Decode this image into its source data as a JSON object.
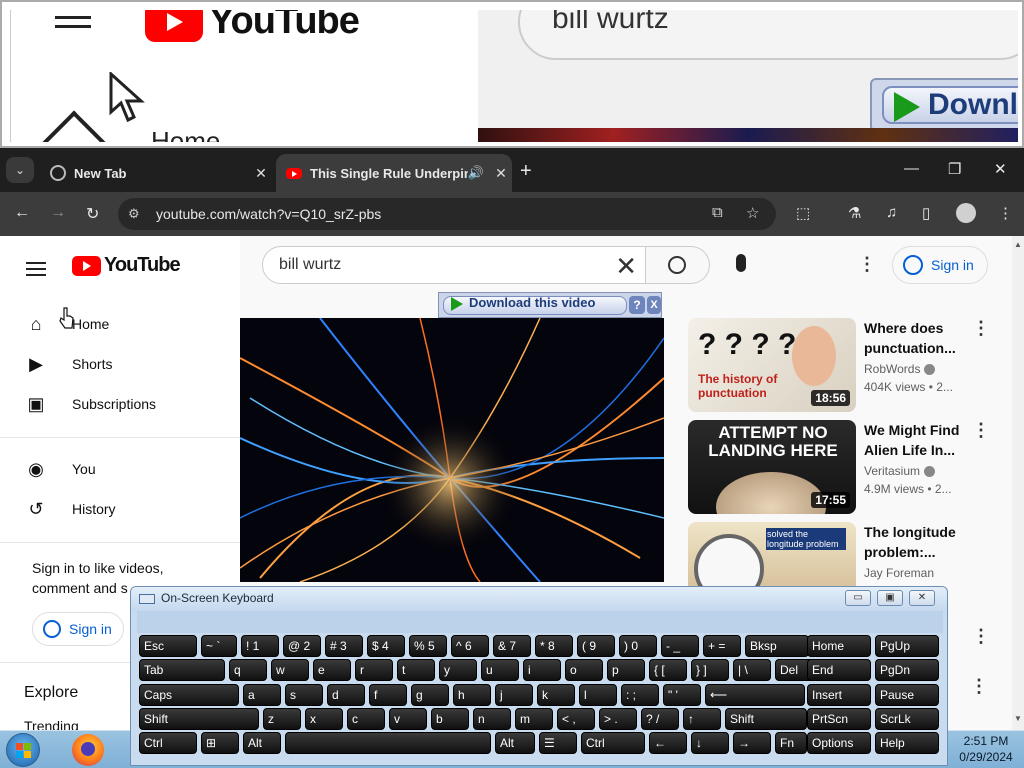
{
  "zoom": {
    "search_text": "bill wurtz",
    "logo": "YouTube",
    "home": "Home",
    "download": "Downl"
  },
  "browser": {
    "tabs": [
      {
        "label": "New Tab",
        "icon": "globe-icon"
      },
      {
        "label": "This Single Rule Underpins",
        "icon": "youtube-favicon",
        "active": true
      }
    ],
    "url": "youtube.com/watch?v=Q10_srZ-pbs"
  },
  "youtube": {
    "logo": "YouTube",
    "search_query": "bill wurtz",
    "sign_in": "Sign in",
    "sidebar": {
      "items": [
        {
          "label": "Home",
          "icon": "home-icon"
        },
        {
          "label": "Shorts",
          "icon": "shorts-icon"
        },
        {
          "label": "Subscriptions",
          "icon": "subscriptions-icon"
        },
        {
          "label": "You",
          "icon": "you-icon"
        },
        {
          "label": "History",
          "icon": "history-icon"
        }
      ],
      "signin_prompt": "Sign in to like videos, comment and s",
      "signin_button": "Sign in",
      "explore": "Explore",
      "trending": "Trending"
    },
    "download_bar": {
      "label": "Download this video",
      "help": "?",
      "close": "X"
    },
    "recommendations": [
      {
        "title": "Where does punctuation...",
        "channel": "RobWords",
        "views": "404K views • 2...",
        "duration": "18:56",
        "thumb_text": "The history of punctuation"
      },
      {
        "title": "We Might Find Alien Life In...",
        "channel": "Veritasium",
        "views": "4.9M views • 2...",
        "duration": "17:55",
        "thumb_text": "ATTEMPT NO LANDING HERE"
      },
      {
        "title": "The longitude problem:...",
        "channel": "Jay Foreman",
        "views": "",
        "duration": "",
        "thumb_text": "solved the longitude problem"
      }
    ]
  },
  "osk": {
    "title": "On-Screen Keyboard",
    "rows": [
      [
        [
          "Esc",
          ""
        ],
        [
          "~ `",
          ""
        ],
        [
          "! 1",
          ""
        ],
        [
          "@ 2",
          ""
        ],
        [
          "# 3",
          ""
        ],
        [
          "$ 4",
          ""
        ],
        [
          "% 5",
          ""
        ],
        [
          "^ 6",
          ""
        ],
        [
          "& 7",
          ""
        ],
        [
          "* 8",
          ""
        ],
        [
          "( 9",
          ""
        ],
        [
          ") 0",
          ""
        ],
        [
          "- _",
          ""
        ],
        [
          "+ =",
          ""
        ],
        [
          "Bksp",
          ""
        ],
        [
          "Home",
          ""
        ],
        [
          "PgUp",
          ""
        ]
      ],
      [
        [
          "Tab",
          ""
        ],
        [
          "q",
          ""
        ],
        [
          "w",
          ""
        ],
        [
          "e",
          ""
        ],
        [
          "r",
          ""
        ],
        [
          "t",
          ""
        ],
        [
          "y",
          ""
        ],
        [
          "u",
          ""
        ],
        [
          "i",
          ""
        ],
        [
          "o",
          ""
        ],
        [
          "p",
          ""
        ],
        [
          "{ [",
          ""
        ],
        [
          "} ]",
          ""
        ],
        [
          "| \\",
          ""
        ],
        [
          "Del",
          ""
        ],
        [
          "End",
          ""
        ],
        [
          "PgDn",
          ""
        ]
      ],
      [
        [
          "Caps",
          ""
        ],
        [
          "a",
          ""
        ],
        [
          "s",
          ""
        ],
        [
          "d",
          ""
        ],
        [
          "f",
          ""
        ],
        [
          "g",
          ""
        ],
        [
          "h",
          ""
        ],
        [
          "j",
          ""
        ],
        [
          "k",
          ""
        ],
        [
          "l",
          ""
        ],
        [
          ": ;",
          ""
        ],
        [
          "\" '",
          ""
        ],
        [
          "⟵",
          ""
        ],
        [
          "Insert",
          ""
        ],
        [
          "Pause",
          ""
        ]
      ],
      [
        [
          "Shift",
          ""
        ],
        [
          "z",
          ""
        ],
        [
          "x",
          ""
        ],
        [
          "c",
          ""
        ],
        [
          "v",
          ""
        ],
        [
          "b",
          ""
        ],
        [
          "n",
          ""
        ],
        [
          "m",
          ""
        ],
        [
          "< ,",
          ""
        ],
        [
          "> .",
          ""
        ],
        [
          "? /",
          ""
        ],
        [
          "↑",
          ""
        ],
        [
          "Shift",
          ""
        ],
        [
          "PrtScn",
          ""
        ],
        [
          "ScrLk",
          ""
        ]
      ],
      [
        [
          "Ctrl",
          ""
        ],
        [
          "⊞",
          ""
        ],
        [
          "Alt",
          ""
        ],
        [
          "",
          ""
        ],
        [
          "Alt",
          ""
        ],
        [
          "☰",
          ""
        ],
        [
          "Ctrl",
          ""
        ],
        [
          "←",
          ""
        ],
        [
          "↓",
          ""
        ],
        [
          "→",
          ""
        ],
        [
          "Fn",
          ""
        ],
        [
          "Options",
          ""
        ],
        [
          "Help",
          ""
        ]
      ]
    ]
  },
  "taskbar": {
    "time": "2:51 PM",
    "date": "0/29/2024"
  }
}
